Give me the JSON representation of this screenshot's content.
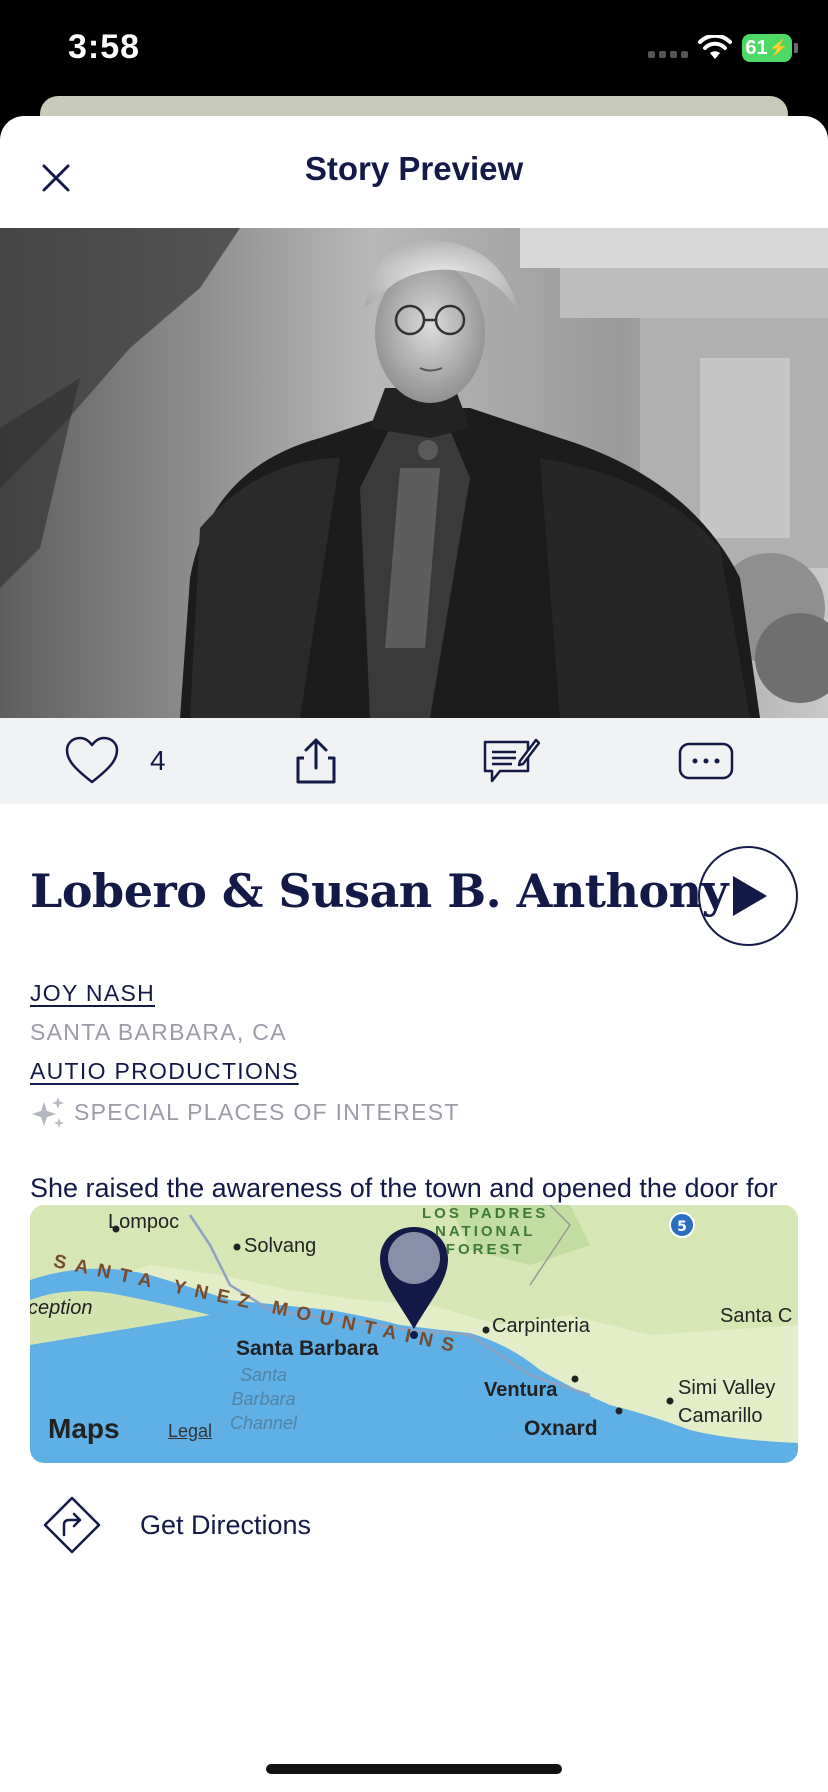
{
  "status_bar": {
    "time": "3:58",
    "battery": "61",
    "icons": [
      "cellular-signal-icon",
      "wifi-icon",
      "battery-charging-icon"
    ]
  },
  "header": {
    "title": "Story Preview",
    "close_icon": "close-icon"
  },
  "actions": {
    "like_icon": "heart-icon",
    "like_count": "4",
    "share_icon": "share-icon",
    "notes_icon": "notes-icon",
    "more_icon": "more-icon"
  },
  "story": {
    "title": "Lobero & Susan B. Anthony",
    "narrator": "JOY NASH",
    "location": "SANTA BARBARA, CA",
    "producer": "AUTIO PRODUCTIONS",
    "category": "SPECIAL PLACES OF INTEREST",
    "category_icon": "sparkles-icon",
    "description": "She raised the awareness of the town and opened the door for women’s rights"
  },
  "map": {
    "places": [
      "Lompoc",
      "Solvang",
      "Santa Barbara",
      "Carpinteria",
      "Santa C",
      "Ventura",
      "Simi Valley",
      "Camarillo",
      "Oxnard",
      "ception"
    ],
    "mountains": "SANTA YNEZ MOUNTAINS",
    "forest": [
      "LOS PADRES",
      "NATIONAL",
      "FOREST"
    ],
    "water": [
      "Santa",
      "Barbara",
      "Channel"
    ],
    "highway_shield": "5",
    "brand": "Maps",
    "legal": "Legal"
  },
  "directions": {
    "label": "Get Directions",
    "icon": "directions-icon"
  },
  "colors": {
    "primary_navy": "#141a47",
    "muted_gray": "#9a9ca8",
    "action_bar_bg": "#f1f2f3"
  }
}
